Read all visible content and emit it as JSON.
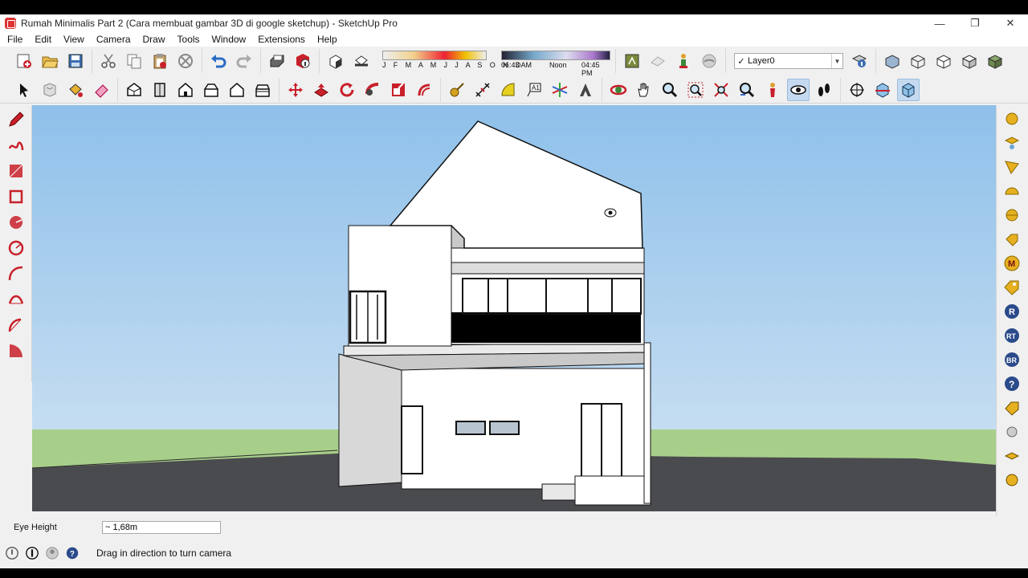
{
  "window": {
    "title": "Rumah Minimalis Part 2 (Cara membuat gambar 3D di google sketchup) - SketchUp Pro",
    "minimize": "—",
    "restore": "❐",
    "close": "✕"
  },
  "menu": [
    "File",
    "Edit",
    "View",
    "Camera",
    "Draw",
    "Tools",
    "Window",
    "Extensions",
    "Help"
  ],
  "shadow_settings": {
    "months": "J F M A M J J A S O N D",
    "time_start": "06:43 AM",
    "time_noon": "Noon",
    "time_end": "04:45 PM"
  },
  "layers": {
    "current": "Layer0",
    "check": "✓"
  },
  "measurements": {
    "label": "Eye Height",
    "value": "~ 1,68m"
  },
  "status": {
    "hint": "Drag in direction to turn camera"
  },
  "colors": {
    "sky": "#9cc8ec",
    "ground": "#a8cf8a",
    "road": "#4a4b4e",
    "accent_red": "#c8202a",
    "toolbar_bg": "#f0f0f0"
  },
  "icons": {
    "toolbar1": [
      "new-model-icon",
      "open-icon",
      "save-icon",
      "cut-icon",
      "copy-icon",
      "paste-icon",
      "erase-icon",
      "undo-icon",
      "redo-icon",
      "print-icon",
      "model-info-icon",
      "shadows-toggle-icon",
      "fog-icon",
      "geo-location-icon",
      "add-location-icon",
      "photo-texture-icon",
      "sandbox-icon",
      "layer-manager-icon",
      "xray-icon",
      "wireframe-icon",
      "hidden-line-icon",
      "shaded-icon",
      "shaded-textures-icon"
    ],
    "toolbar2": [
      "select-icon",
      "make-component-icon",
      "paint-bucket-icon",
      "eraser-icon",
      "iso-view-icon",
      "top-view-icon",
      "front-view-icon",
      "right-view-icon",
      "back-view-icon",
      "left-view-icon",
      "move-icon",
      "push-pull-icon",
      "rotate-icon",
      "follow-me-icon",
      "scale-icon",
      "offset-icon",
      "tape-measure-icon",
      "dimension-icon",
      "protractor-icon",
      "text-icon",
      "axes-icon",
      "3d-text-icon",
      "orbit-icon",
      "pan-icon",
      "zoom-icon",
      "zoom-window-icon",
      "zoom-extents-icon",
      "previous-view-icon",
      "position-camera-icon",
      "look-around-icon",
      "walk-icon",
      "section-plane-icon",
      "display-section-planes-icon",
      "display-section-cuts-icon"
    ],
    "left": [
      "pencil-icon",
      "freehand-icon",
      "rectangle-icon",
      "rotated-rectangle-icon",
      "circle-icon",
      "polygon-icon",
      "arc-icon",
      "two-point-arc-icon",
      "three-point-arc-icon",
      "pie-icon"
    ],
    "right": [
      "sphere-icon",
      "flip-icon",
      "arrow-tool-icon",
      "dome-icon",
      "ball-icon",
      "tag-icon",
      "extension-m-icon",
      "extension-tag-icon",
      "extension-r-icon",
      "extension-rt-icon",
      "extension-br-icon",
      "help-icon",
      "label-icon",
      "orbit-ball-icon",
      "flatten-icon",
      "extra-icon"
    ],
    "status": [
      "geo-status-icon",
      "credits-status-icon",
      "user-status-icon",
      "help-status-icon"
    ]
  }
}
